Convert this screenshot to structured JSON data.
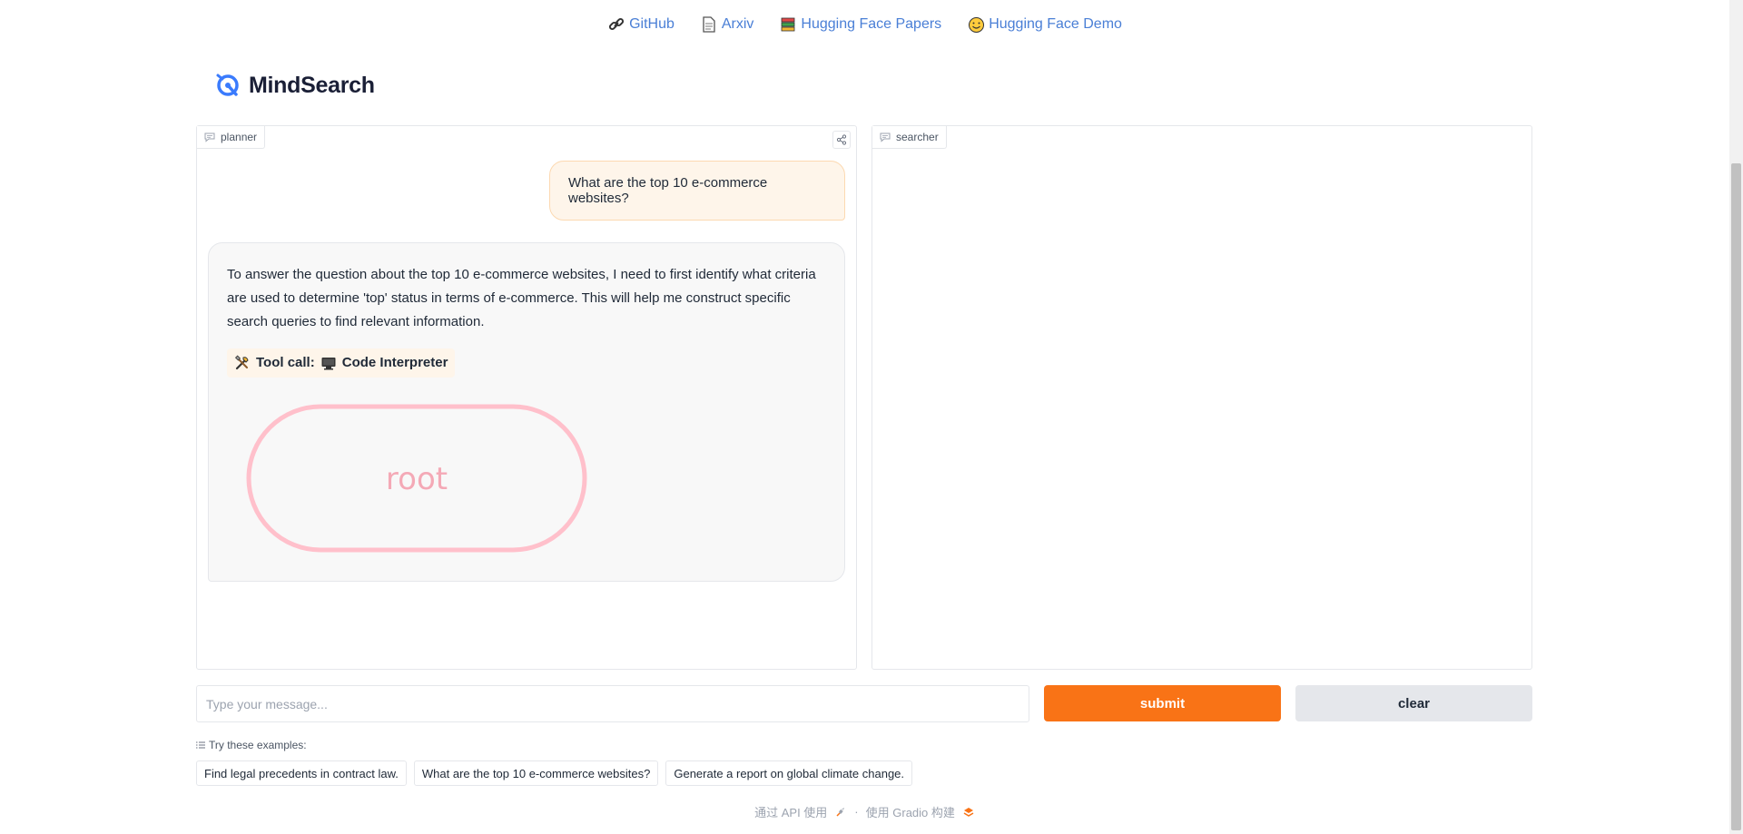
{
  "top_links": [
    {
      "icon": "link-icon",
      "label": "GitHub"
    },
    {
      "icon": "document-icon",
      "label": "Arxiv"
    },
    {
      "icon": "books-icon",
      "label": "Hugging Face Papers"
    },
    {
      "icon": "hugging-face-icon",
      "label": "Hugging Face Demo"
    }
  ],
  "logo": {
    "name": "MindSearch"
  },
  "planner": {
    "label": "planner",
    "user_message": "What are the top 10 e-commerce websites?",
    "bot_message": "To answer the question about the top 10 e-commerce websites, I need to first identify what criteria are used to determine 'top' status in terms of e-commerce. This will help me construct specific search queries to find relevant information.",
    "tool_call_label": "Tool call:",
    "tool_name": "Code Interpreter",
    "graph_node": "root"
  },
  "searcher": {
    "label": "searcher"
  },
  "input": {
    "placeholder": "Type your message..."
  },
  "buttons": {
    "submit": "submit",
    "clear": "clear"
  },
  "examples": {
    "label": "Try these examples:",
    "items": [
      "Find legal precedents in contract law.",
      "What are the top 10 e-commerce websites?",
      "Generate a report on global climate change."
    ]
  },
  "footer": {
    "api": "通过 API 使用",
    "separator": "·",
    "built": "使用 Gradio 构建"
  },
  "colors": {
    "accent": "#f97316",
    "link": "#4a7fd6",
    "graph_node": "#ffc0cb"
  }
}
